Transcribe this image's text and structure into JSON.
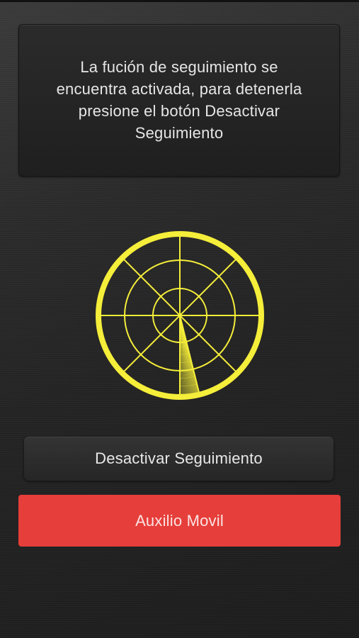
{
  "message": {
    "text": "La fución de seguimiento se encuentra activada, para detenerla presione el botón Desactivar Seguimiento"
  },
  "radar": {
    "icon": "radar-icon",
    "color": "#f5ee3a"
  },
  "buttons": {
    "deactivate_label": "Desactivar Seguimiento",
    "auxilio_label": "Auxilio Movil"
  },
  "colors": {
    "accent_red": "#e63e3a",
    "radar_yellow": "#f5ee3a"
  }
}
